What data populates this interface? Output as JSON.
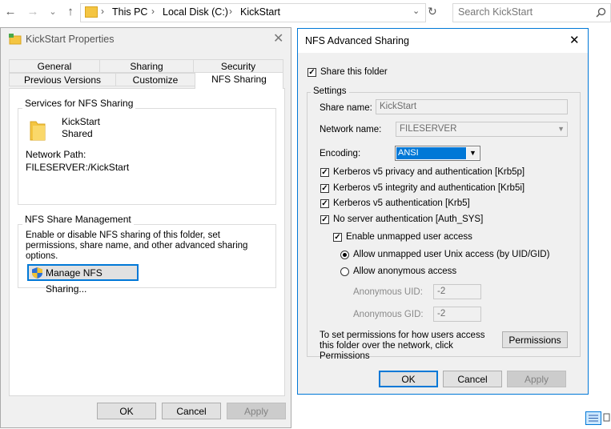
{
  "explorer": {
    "back_icon": "←",
    "forward_icon": "→",
    "recent_icon": "⌄",
    "up_icon": "↑",
    "breadcrumb": [
      "This PC",
      "Local Disk (C:)",
      "KickStart"
    ],
    "search_placeholder": "Search KickStart"
  },
  "properties": {
    "title": "KickStart Properties",
    "tabs_row1": [
      "General",
      "Sharing",
      "Security"
    ],
    "tabs_row2": [
      "Previous Versions",
      "Customize",
      "NFS Sharing"
    ],
    "selected_tab": "NFS Sharing",
    "services_group": "Services for NFS Sharing",
    "folder_name": "KickStart",
    "folder_status": "Shared",
    "network_path_label": "Network Path:",
    "network_path": "FILESERVER:/KickStart",
    "mgmt_group": "NFS Share Management",
    "mgmt_desc": "Enable or disable NFS sharing of this folder, set permissions, share name, and other advanced sharing options.",
    "manage_button": "Manage NFS Sharing...",
    "ok": "OK",
    "cancel": "Cancel",
    "apply": "Apply"
  },
  "advanced": {
    "title": "NFS Advanced Sharing",
    "share_this_folder": "Share this folder",
    "share_checked": true,
    "settings_group": "Settings",
    "share_name_label": "Share name:",
    "share_name": "KickStart",
    "network_name_label": "Network name:",
    "network_name": "FILESERVER",
    "encoding_label": "Encoding:",
    "encoding": "ANSI",
    "auth_options": [
      {
        "label": "Kerberos v5 privacy and authentication [Krb5p]",
        "checked": true
      },
      {
        "label": "Kerberos v5 integrity and authentication [Krb5i]",
        "checked": true
      },
      {
        "label": "Kerberos v5 authentication [Krb5]",
        "checked": true
      },
      {
        "label": "No server authentication [Auth_SYS]",
        "checked": true
      }
    ],
    "enable_unmapped": "Enable unmapped user access",
    "radio_unix": "Allow unmapped user Unix access (by UID/GID)",
    "radio_anon": "Allow anonymous access",
    "anon_uid_label": "Anonymous UID:",
    "anon_uid": "-2",
    "anon_gid_label": "Anonymous GID:",
    "anon_gid": "-2",
    "perm_desc": "To set permissions for how users access this folder over the network, click Permissions",
    "permissions_button": "Permissions",
    "ok": "OK",
    "cancel": "Cancel",
    "apply": "Apply"
  },
  "colors": {
    "accent": "#0078d7",
    "selection": "#0078d7",
    "folder": "#f4c542"
  }
}
